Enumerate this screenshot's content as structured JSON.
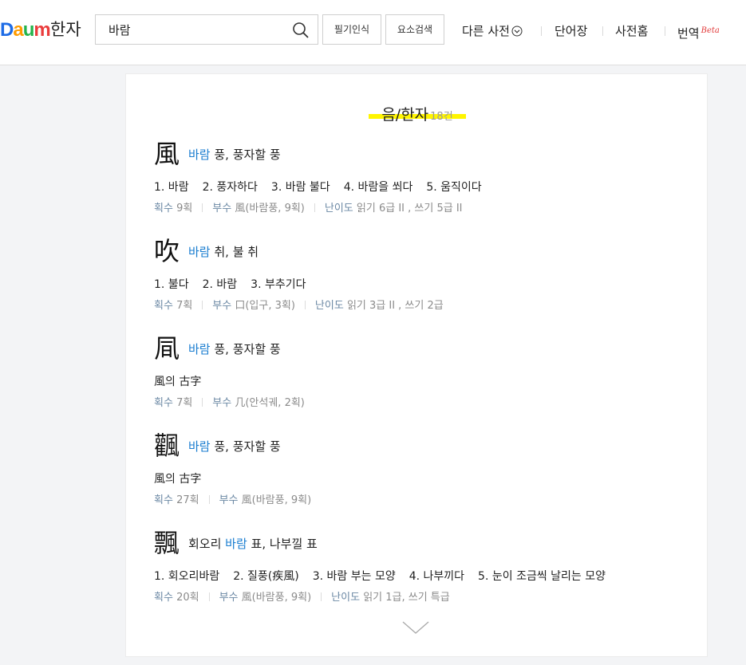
{
  "header": {
    "logo_letters": [
      "D",
      "a",
      "u",
      "m"
    ],
    "logo_colors": [
      "#1e6ce6",
      "#ff9c00",
      "#24b34b",
      "#ea3c3c"
    ],
    "service_name": "한자",
    "search": {
      "value": "바람",
      "icon": "search-icon"
    },
    "buttons": {
      "handwriting": "필기인식",
      "element_search": "요소검색"
    },
    "nav": {
      "other_dict": "다른 사전",
      "other_dict_icon": "chevron-down-circle-icon",
      "vocab": "단어장",
      "dict_home": "사전홈",
      "translate": "번역",
      "translate_badge": "Beta"
    }
  },
  "result": {
    "section_title": "음/한자",
    "count": "18건",
    "entries": [
      {
        "hanja": "風",
        "prefix": "",
        "keyword": "바람",
        "rest": " 풍, 풍자할 풍",
        "defs": [
          "1. 바람",
          "2. 풍자하다",
          "3. 바람 불다",
          "4. 바람을 쐬다",
          "5. 움직이다"
        ],
        "meta": [
          {
            "label": "획수",
            "value": "9획"
          },
          {
            "label": "부수",
            "value": "風(바람풍, 9획)"
          },
          {
            "label": "난이도",
            "value": "읽기 6급 II , 쓰기 5급 II"
          }
        ]
      },
      {
        "hanja": "吹",
        "prefix": "",
        "keyword": "바람",
        "rest": " 취, 불 취",
        "defs": [
          "1. 불다",
          "2. 바람",
          "3. 부추기다"
        ],
        "meta": [
          {
            "label": "획수",
            "value": "7획"
          },
          {
            "label": "부수",
            "value": "口(입구, 3획)"
          },
          {
            "label": "난이도",
            "value": "읽기 3급 II , 쓰기 2급"
          }
        ]
      },
      {
        "hanja": "凬",
        "prefix": "",
        "keyword": "바람",
        "rest": " 풍, 풍자할 풍",
        "defs": [
          "風의 古字"
        ],
        "meta": [
          {
            "label": "획수",
            "value": "7획"
          },
          {
            "label": "부수",
            "value": "几(안석궤, 2획)"
          }
        ]
      },
      {
        "hanja": "飌",
        "prefix": "",
        "keyword": "바람",
        "rest": " 풍, 풍자할 풍",
        "defs": [
          "風의 古字"
        ],
        "meta": [
          {
            "label": "획수",
            "value": "27획"
          },
          {
            "label": "부수",
            "value": "風(바람풍, 9획)"
          }
        ]
      },
      {
        "hanja": "飄",
        "prefix": "회오리 ",
        "keyword": "바람",
        "rest": " 표, 나부낄 표",
        "defs": [
          "1. 회오리바람",
          "2. 질풍(疾風)",
          "3. 바람 부는 모양",
          "4. 나부끼다",
          "5. 눈이 조금씩 날리는 모양"
        ],
        "meta": [
          {
            "label": "획수",
            "value": "20획"
          },
          {
            "label": "부수",
            "value": "風(바람풍, 9획)"
          },
          {
            "label": "난이도",
            "value": "읽기 1급, 쓰기 특급"
          }
        ]
      }
    ],
    "more_icon": "chevron-down-icon"
  }
}
